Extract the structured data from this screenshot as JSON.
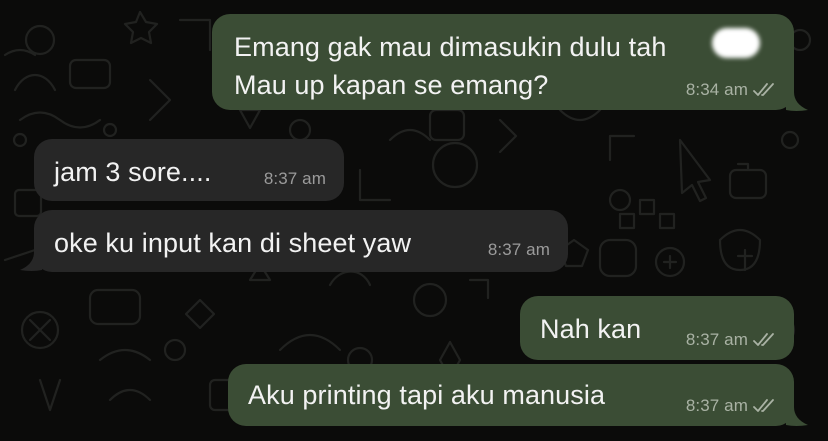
{
  "messages": [
    {
      "id": "m1",
      "direction": "outgoing",
      "text_line1": "Emang gak mau dimasukin dulu tah",
      "text_line2": "Mau up kapan se emang?",
      "time": "8:34 am",
      "status": "read"
    },
    {
      "id": "m2",
      "direction": "incoming",
      "text": "jam 3 sore....",
      "time": "8:37 am"
    },
    {
      "id": "m3",
      "direction": "incoming",
      "text": "oke ku input kan di sheet yaw",
      "time": "8:37 am"
    },
    {
      "id": "m4",
      "direction": "outgoing",
      "text": "Nah kan",
      "time": "8:37 am",
      "status": "read"
    },
    {
      "id": "m5",
      "direction": "outgoing",
      "text": "Aku printing tapi aku manusia",
      "time": "8:37 am",
      "status": "read"
    }
  ],
  "colors": {
    "background": "#0b0b0a",
    "outgoing_bubble": "#3b4d35",
    "incoming_bubble": "#272727",
    "text": "#f2f2f2",
    "meta_outgoing": "#a9b2a4",
    "meta_incoming": "#9b9b9b"
  },
  "icons": {
    "read_receipt": "double-check-icon",
    "redaction": "redaction-blob"
  }
}
